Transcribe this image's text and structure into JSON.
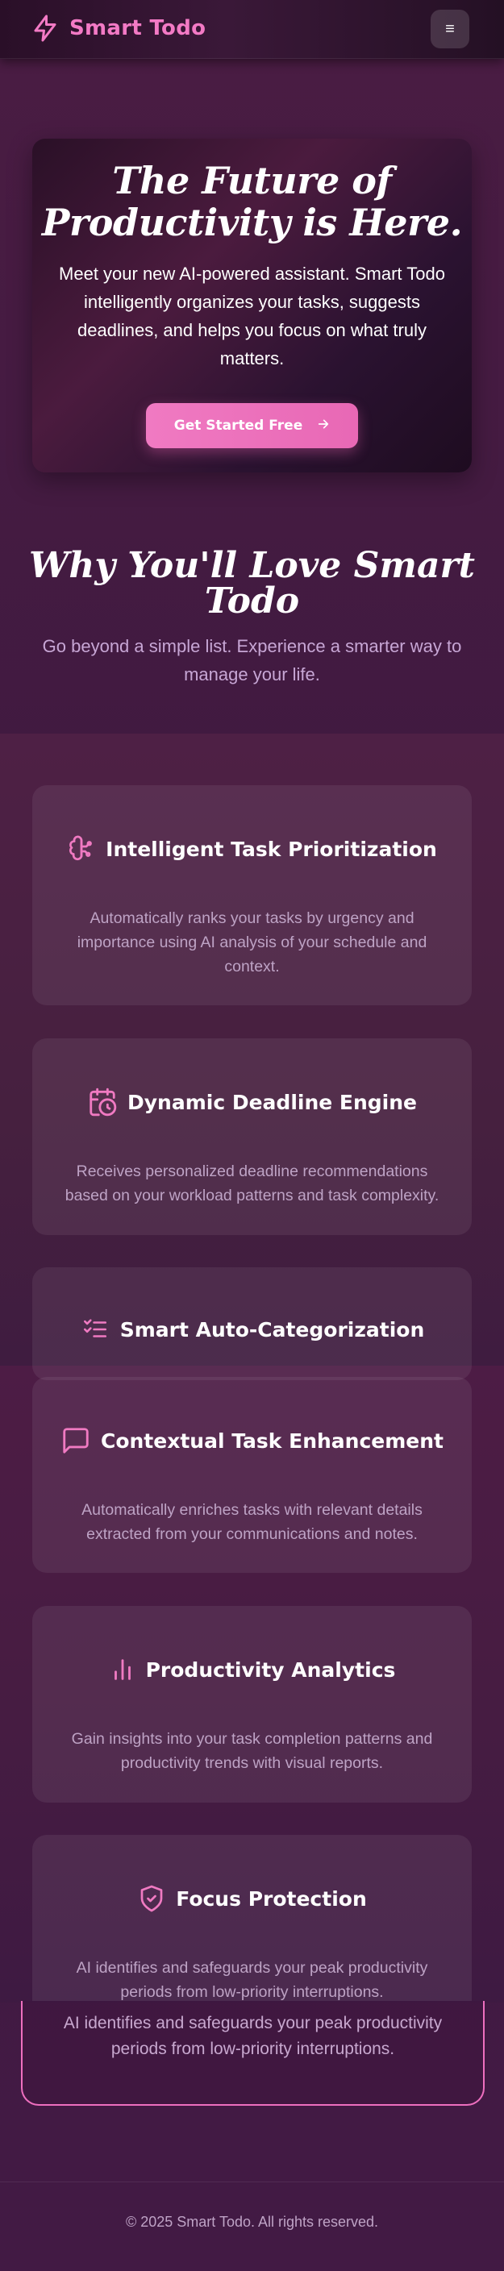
{
  "nav": {
    "brand": "Smart Todo",
    "menu_icon": "menu-icon",
    "bolt_icon": "bolt-icon"
  },
  "hero": {
    "title_line1": "The Future of",
    "title_line2": "Productivity is Here.",
    "description": "Meet your new AI-powered assistant. Smart Todo intelligently organizes your tasks, suggests deadlines, and helps you focus on what truly matters.",
    "cta_label": "Get Started Free"
  },
  "why": {
    "title_line1": "Why You'll Love Smart",
    "title_line2": "Todo",
    "subtitle": "Go beyond a simple list. Experience a smarter way to manage your life."
  },
  "features": [
    {
      "icon": "brain-icon",
      "title": "Intelligent Task Prioritization",
      "description": "Automatically ranks your tasks by urgency and importance using AI analysis of your schedule and context."
    },
    {
      "icon": "calendar-clock-icon",
      "title": "Dynamic Deadline Engine",
      "description": "Receives personalized deadline recommendations based on your workload patterns and task complexity."
    },
    {
      "icon": "list-check-icon",
      "title": "Smart Auto-Categorization",
      "description": ""
    },
    {
      "icon": "message-icon",
      "title": "Contextual Task Enhancement",
      "description": "Automatically enriches tasks with relevant details extracted from your communications and notes."
    },
    {
      "icon": "bar-chart-icon",
      "title": "Productivity Analytics",
      "description": "Gain insights into your task completion patterns and productivity trends with visual reports."
    },
    {
      "icon": "shield-check-icon",
      "title": "Focus Protection",
      "description": "AI identifies and safeguards your peak productivity periods from low-priority interruptions."
    }
  ],
  "focus_highlight": {
    "description": "AI identifies and safeguards your peak productivity periods from low-priority interruptions."
  },
  "footer": {
    "copyright": "© 2025 Smart Todo. All rights reserved."
  },
  "colors": {
    "accent": "#f07ac2",
    "bg": "#421a44"
  }
}
